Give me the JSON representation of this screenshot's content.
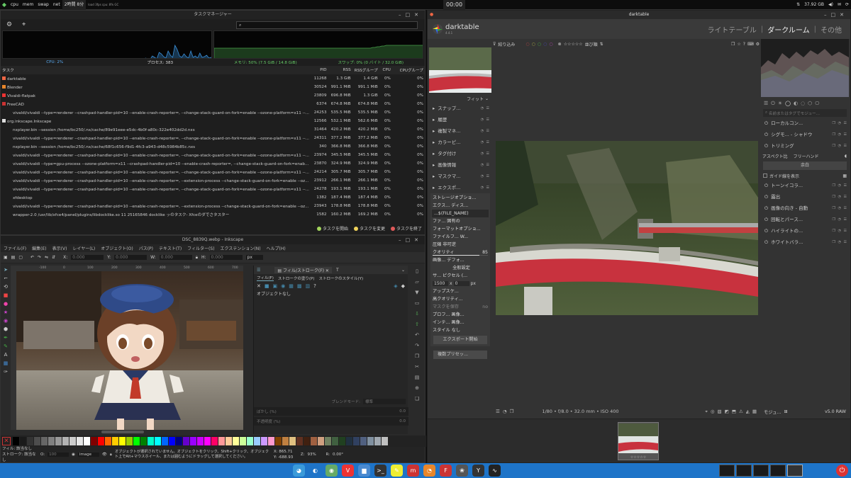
{
  "topbar": {
    "items": [
      "cpu",
      "mem",
      "swap",
      "net"
    ],
    "uptime": "2時間 8分",
    "tiny": "load 3fps cpu: 8% GC",
    "clock": "00:00",
    "storage": "37.92 GB"
  },
  "taskmanager": {
    "title": "タスクマネージャー",
    "search_placeholder": "",
    "cpu": "CPU: 2%",
    "processes": "プロセス: 383",
    "memory": "メモリ: 50% (7.5 GiB / 14.8 GiB)",
    "swap": "スワップ: 0% (0 バイト / 32.0 GiB)",
    "columns": [
      "タスク",
      "PID",
      "RSS",
      "RSSグループ",
      "CPU",
      "CPUグループ"
    ],
    "rows": [
      {
        "name": "darktable",
        "pid": "11268",
        "rss": "1.3 GiB",
        "grp": "1.4 GiB",
        "cpu": "0%",
        "cpug": "0%",
        "icon": "dt"
      },
      {
        "name": "Blender",
        "pid": "30524",
        "rss": "991.1 MiB",
        "grp": "991.1 MiB",
        "cpu": "0%",
        "cpug": "0%",
        "icon": "bl"
      },
      {
        "name": "Vivaldi-flatpak",
        "pid": "23809",
        "rss": "696.8 MiB",
        "grp": "1.3 GiB",
        "cpu": "0%",
        "cpug": "0%",
        "icon": "vv"
      },
      {
        "name": "FreeCAD",
        "pid": "6374",
        "rss": "674.8 MiB",
        "grp": "674.8 MiB",
        "cpu": "0%",
        "cpug": "0%",
        "icon": "fc"
      },
      {
        "name": "vivaldi/vivaldi --type=renderer --crashpad-handler-pid=10 --enable-crash-reporter=, --change-stack-guard-on-fork=enable --ozone-platform=x11 --...",
        "pid": "24253",
        "rss": "535.5 MiB",
        "grp": "535.5 MiB",
        "cpu": "0%",
        "cpug": "0%",
        "icon": ""
      },
      {
        "name": "org.inkscape.Inkscape",
        "pid": "12566",
        "rss": "532.1 MiB",
        "grp": "562.6 MiB",
        "cpu": "0%",
        "cpug": "0%",
        "icon": "ik"
      },
      {
        "name": "nxplayer.bin --session /home/bc250/.nx/cache/89e91eee-e5dc-4b0f-a80c-322e402dd2d.nxs",
        "pid": "31464",
        "rss": "420.2 MiB",
        "grp": "420.2 MiB",
        "cpu": "0%",
        "cpug": "0%",
        "icon": ""
      },
      {
        "name": "vivaldi/vivaldi --type=renderer --crashpad-handler-pid=10 --enable-crash-reporter=, --change-stack-guard-on-fork=enable --ozone-platform=x11 --...",
        "pid": "24311",
        "rss": "377.2 MiB",
        "grp": "377.2 MiB",
        "cpu": "0%",
        "cpug": "0%",
        "icon": ""
      },
      {
        "name": "nxplayer.bin --session /home/bc250/.nx/cache/68f1c656-f9d1-4fc3-a943-d48c5984b85c.nxs",
        "pid": "340",
        "rss": "366.8 MiB",
        "grp": "366.8 MiB",
        "cpu": "0%",
        "cpug": "0%",
        "icon": ""
      },
      {
        "name": "vivaldi/vivaldi --type=renderer --crashpad-handler-pid=10 --enable-crash-reporter=, --change-stack-guard-on-fork=enable --ozone-platform=x11 --...",
        "pid": "23974",
        "rss": "345.5 MiB",
        "grp": "345.5 MiB",
        "cpu": "0%",
        "cpug": "0%",
        "icon": ""
      },
      {
        "name": "vivaldi/vivaldi --type=gpu-process --ozone-platform=x11 --crashpad-handler-pid=10 --enable-crash-reporter=, --change-stack-guard-on-fork=enab...",
        "pid": "23870",
        "rss": "324.9 MiB",
        "grp": "324.9 MiB",
        "cpu": "0%",
        "cpug": "0%",
        "icon": ""
      },
      {
        "name": "vivaldi/vivaldi --type=renderer --crashpad-handler-pid=10 --enable-crash-reporter=, --change-stack-guard-on-fork=enable --ozone-platform=x11 --...",
        "pid": "24214",
        "rss": "305.7 MiB",
        "grp": "305.7 MiB",
        "cpu": "0%",
        "cpug": "0%",
        "icon": ""
      },
      {
        "name": "vivaldi/vivaldi --type=renderer --crashpad-handler-pid=10 --enable-crash-reporter=, --extension-process --change-stack-guard-on-fork=enable --oz...",
        "pid": "23912",
        "rss": "266.1 MiB",
        "grp": "266.1 MiB",
        "cpu": "0%",
        "cpug": "0%",
        "icon": ""
      },
      {
        "name": "vivaldi/vivaldi --type=renderer --crashpad-handler-pid=10 --enable-crash-reporter=, --change-stack-guard-on-fork=enable --ozone-platform=x11 --...",
        "pid": "24278",
        "rss": "193.1 MiB",
        "grp": "193.1 MiB",
        "cpu": "0%",
        "cpug": "0%",
        "icon": ""
      },
      {
        "name": "xfdesktop",
        "pid": "1382",
        "rss": "187.4 MiB",
        "grp": "187.4 MiB",
        "cpu": "0%",
        "cpug": "0%",
        "icon": ""
      },
      {
        "name": "vivaldi/vivaldi --type=renderer --crashpad-handler-pid=10 --enable-crash-reporter=, --extension-process --change-stack-guard-on-fork=enable --oz...",
        "pid": "23943",
        "rss": "178.8 MiB",
        "grp": "178.8 MiB",
        "cpu": "0%",
        "cpug": "0%",
        "icon": ""
      },
      {
        "name": "wrapper-2.0 /usr/lib/xfce4/panel/plugins/libdocklike.so 11 25165846 docklike ッのタスク- Xfceのダでさタスター",
        "pid": "1582",
        "rss": "160.2 MiB",
        "grp": "169.2 MiB",
        "cpu": "0%",
        "cpug": "0%",
        "icon": ""
      }
    ],
    "legend": [
      "タスクを開始",
      "タスクを変更",
      "タスクを終了"
    ],
    "legend_colors": [
      "#a3d65c",
      "#f1d35b",
      "#e05a5a"
    ]
  },
  "inkscape": {
    "title": "DSC_8839Q.webp - Inkscape",
    "menu": [
      "ファイル(F)",
      "編集(E)",
      "表示(V)",
      "レイヤー(L)",
      "オブジェクト(O)",
      "パス(P)",
      "テキスト(T)",
      "フィルター(S)",
      "エクステンション(N)",
      "ヘルプ(H)"
    ],
    "coord_x": "0.000",
    "coord_y": "0.000",
    "w": "0.000",
    "h": "0.000",
    "unit": "px",
    "ruler": [
      "-100",
      "0",
      "100",
      "200",
      "300",
      "400",
      "500",
      "600",
      "700",
      "800"
    ],
    "panel_tab": "フィル/ストローク(F)",
    "sub_tabs": [
      "フィル(F)",
      "ストロークの塗り(P)",
      "ストロークのスタイル(Y)"
    ],
    "no_object": "オブジェクトなし",
    "blend_label": "ブレンドモード:",
    "blend_value": "標準",
    "blur_label": "ぼかし (%)",
    "blur_value": "0.0",
    "opacity_label": "不透明度 (%)",
    "opacity_value": "0.0",
    "status_fill_label": "フィル:",
    "status_fill": "該当なし",
    "status_stroke_label": "ストローク:",
    "status_stroke": "該当なし",
    "layer": "image",
    "o_label": "O:",
    "o_value": "100",
    "status_msg": "オブジェクトが選択されていません。オブジェクトをクリック、Shift+クリック、オブジェクト上でAlt+マウスホイール、または囲むようにドラッグして選択してください。",
    "x_readout": "X: 865.71",
    "y_readout": "Y: -688.93",
    "zoom": "93%",
    "rotation": "0.00°",
    "palette": [
      "#000000",
      "#1a1a1a",
      "#333333",
      "#4d4d4d",
      "#666666",
      "#808080",
      "#999999",
      "#b3b3b3",
      "#cccccc",
      "#e6e6e6",
      "#ffffff",
      "#800000",
      "#ff0000",
      "#ff6600",
      "#ffcc00",
      "#ffff00",
      "#99cc00",
      "#00ff00",
      "#008000",
      "#00ffcc",
      "#00ffff",
      "#0066ff",
      "#0000ff",
      "#000080",
      "#6600cc",
      "#9900ff",
      "#cc00ff",
      "#ff00ff",
      "#ff0066",
      "#ff9999",
      "#ffcc99",
      "#ffff99",
      "#ccff99",
      "#99ffcc",
      "#99ccff",
      "#cc99ff",
      "#ff99cc",
      "#804000",
      "#c08040",
      "#e0c080",
      "#603020",
      "#402010",
      "#a06040",
      "#d0a080",
      "#708060",
      "#406040",
      "#204020",
      "#203040",
      "#304060",
      "#506080",
      "#8090a0",
      "#a0a8b0",
      "#c0c0c0"
    ]
  },
  "darktable": {
    "window_title": "darktable",
    "logo": "darktable",
    "version": "4.4.1",
    "views": [
      "ライトテーブル",
      "ダークルーム",
      "その他"
    ],
    "filter_label": "絞り込み",
    "sort_label": "並び順",
    "fit": "フィット",
    "left_modules": [
      "スナップ...",
      "履歴",
      "複製マネ...",
      "カラーピ...",
      "タグ付け",
      "画像情報",
      "マスクマ...",
      "エクスポ..."
    ],
    "export": {
      "storage": "ストレージオプショ...",
      "target": "エクス... ディス...",
      "path": "...$(FILE_NAME)",
      "file": "ファ... 固有の",
      "format_opts": "フォーマットオプショ...",
      "file_format": "ファイルフ... W...",
      "compression": "圧縮 非可逆",
      "quality_label": "クオリティ",
      "quality_value": "85",
      "image": "画像... デフォ...",
      "global": "全般設定",
      "size": "サ... ピクセル (...",
      "width": "1500",
      "x": "x",
      "height": "0",
      "unit": "px",
      "upscale": "アップスケ...",
      "hq": "高クオリティ...",
      "masks": "マスクを保存",
      "masks_val": "no",
      "profile": "プロフ... 画像...",
      "intent": "インテ... 画像...",
      "style": "スタイル なし",
      "button": "エクスポート開始",
      "preset": "複数プリセッ..."
    },
    "right_search": "名前またはタグでモジュー...",
    "right_modules": [
      "ローカルコン...",
      "シグモ... - シャドウ",
      "トリミング"
    ],
    "aspect_label": "アスペクト比",
    "aspect_value": "フリーハンド",
    "margin_label": "余白",
    "guides_label": "ガイド線を表示",
    "right_modules2": [
      "トーンイコラ...",
      "露出",
      "画像の向き - 自動",
      "回転とパース...",
      "ハイライトの...",
      "ホワイトバラ..."
    ],
    "exif": "1/80 • f/8.0 • 32.0 mm • ISO 400",
    "module_label": "モジュ...",
    "raw": "v5.0 RAW",
    "stars": "☆☆☆☆☆"
  },
  "taskbar": {
    "icons": [
      "bluetooth-app",
      "vivaldi-browser",
      "gimp",
      "vivaldi-2",
      "file-manager",
      "terminal",
      "notes",
      "imager",
      "blender",
      "freecad",
      "darktable",
      "gimp-2",
      "system-monitor"
    ],
    "power": "power"
  },
  "cpu_graph": [
    0,
    0,
    0,
    0,
    0,
    0,
    0,
    0,
    0,
    0,
    0,
    0,
    0,
    0,
    0,
    0,
    0,
    0,
    0,
    0,
    0,
    0,
    0,
    0,
    0,
    0,
    0,
    0,
    0,
    0,
    0,
    0,
    0,
    0,
    0,
    0,
    0,
    0,
    0,
    0,
    0,
    0,
    0,
    0,
    0,
    0,
    0,
    0,
    0,
    0,
    0,
    0,
    0,
    0,
    0,
    0,
    0,
    0,
    0,
    0,
    0,
    1,
    0,
    2,
    1,
    0,
    5,
    3,
    1,
    10,
    8,
    4,
    2,
    12,
    6,
    3,
    20,
    14,
    5,
    3,
    8,
    4,
    2,
    12,
    3,
    5,
    2,
    9,
    3,
    4,
    6,
    2,
    3,
    4
  ],
  "mem_graph": [
    16,
    16,
    16,
    16,
    16,
    16,
    16,
    16,
    16,
    16,
    16,
    16,
    16,
    16,
    16,
    16,
    16,
    16,
    16,
    16,
    16,
    16,
    16,
    16,
    16,
    16,
    16,
    16,
    16,
    16,
    16,
    16,
    16,
    16,
    16,
    16,
    16,
    16,
    16,
    16,
    16,
    16,
    16,
    16,
    16,
    16,
    16,
    16,
    16,
    16,
    16,
    16,
    16,
    16,
    16,
    16,
    16,
    16,
    16,
    16,
    16,
    16,
    16,
    16,
    16,
    16,
    16,
    16,
    16,
    16,
    17,
    17,
    18,
    18,
    19,
    19,
    20,
    20,
    20,
    20,
    20,
    20,
    20,
    20,
    20,
    20,
    20,
    20,
    20,
    20,
    20,
    20,
    20,
    20
  ]
}
